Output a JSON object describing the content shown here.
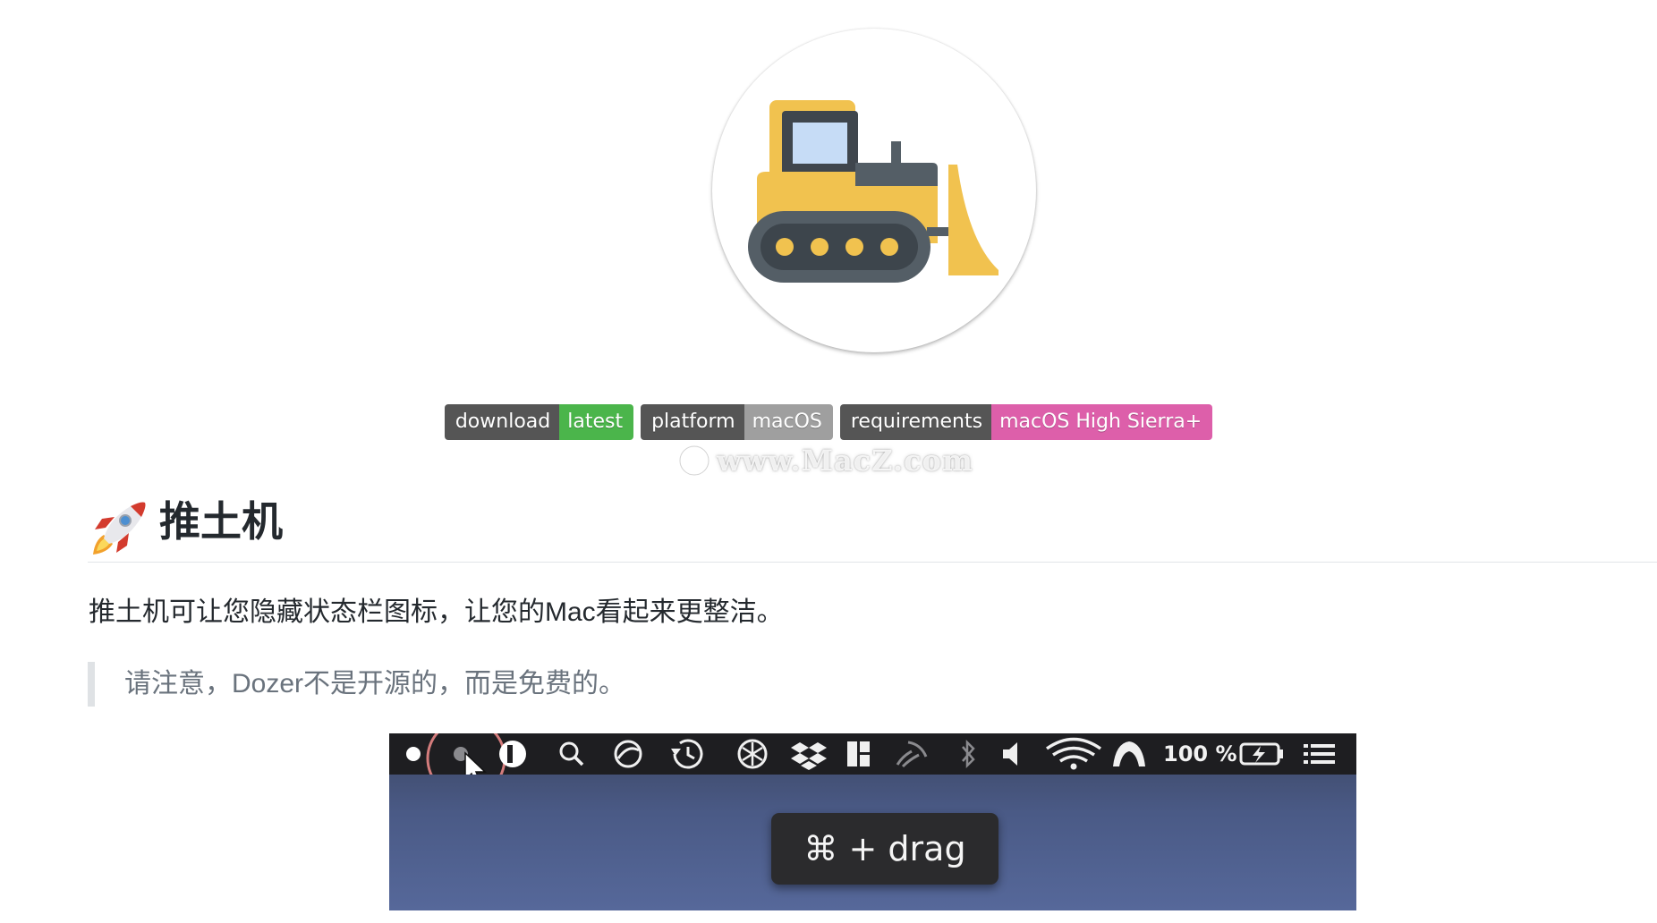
{
  "heading": {
    "emoji_icon": "rocket-icon",
    "title": "推土机"
  },
  "badges": [
    {
      "label": "download",
      "value": "latest",
      "color": "#4bb54b"
    },
    {
      "label": "platform",
      "value": "macOS",
      "color": "#9f9f9f"
    },
    {
      "label": "requirements",
      "value": "macOS High Sierra+",
      "color": "#dd5faa"
    }
  ],
  "watermark": {
    "text": "www.MacZ.com"
  },
  "description": "推土机可让您隐藏状态栏图标，让您的Mac看起来更整洁。",
  "note": "请注意，Dozer不是开源的，而是免费的。",
  "demo": {
    "battery_percent": "100 %",
    "tooltip": "⌘ + drag",
    "menubar_icons": [
      "dozer-dot-icon",
      "dozer-dot-icon",
      "1password-icon",
      "spotlight-search-icon",
      "sync-icon",
      "time-machine-icon",
      "snowflake-icon",
      "dropbox-icon",
      "layout-icon",
      "airplay-icon",
      "bluetooth-icon",
      "volume-icon",
      "wifi-icon",
      "arc-icon",
      "battery-icon",
      "list-menu-icon"
    ]
  },
  "colors": {
    "logo_yellow": "#f1c24f",
    "logo_dark": "#545e66",
    "logo_window": "#c6dcf6",
    "menubar": "#1e1e21",
    "quote_bar": "#dfe2e5"
  }
}
